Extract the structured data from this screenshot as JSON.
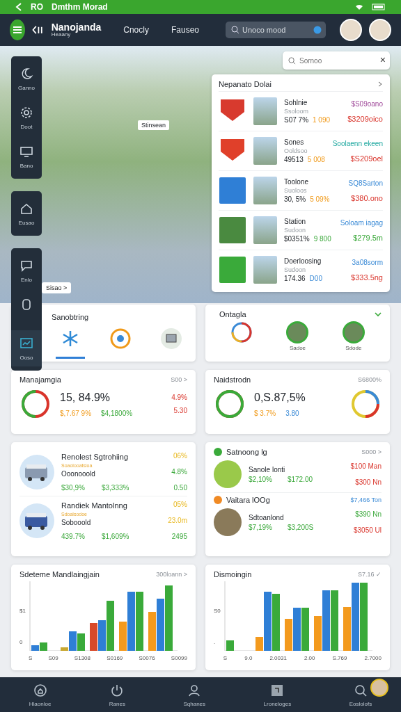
{
  "status_bar": {
    "carrier": "RO",
    "title": "Dmthm Morad"
  },
  "header": {
    "title": "Nanojanda",
    "subtitle": "Heaany",
    "nav": [
      "Cnocly",
      "Fauseo"
    ],
    "search": {
      "placeholder": "Unoco mood"
    }
  },
  "map": {
    "search": {
      "placeholder": "Sornoo",
      "close": "×"
    },
    "tags": [
      {
        "kind": "pin",
        "label": "Stinsean"
      },
      {
        "kind": "link",
        "label": "Sisao >"
      }
    ]
  },
  "sidebar": {
    "groups": [
      {
        "items": [
          {
            "label": "Ganno",
            "selected": false
          },
          {
            "label": "Doot",
            "selected": false
          },
          {
            "label": "Bano",
            "selected": false
          }
        ]
      },
      {
        "items": [
          {
            "label": "Eusao",
            "selected": false
          }
        ]
      },
      {
        "items": [
          {
            "label": "Enlo",
            "selected": false
          },
          {
            "selected": false
          },
          {
            "label": "Ooso",
            "selected": true
          }
        ]
      }
    ]
  },
  "list_card": {
    "title": "Nepanato Dolai",
    "rows": [
      {
        "kind": "shield",
        "color": "#d83a2e",
        "title": "Sohlnie",
        "subtitle": "Ssoloom",
        "value": "S07 7%",
        "change": "1 090",
        "top": "$S09oano",
        "bottom": "$3209oico"
      },
      {
        "kind": "shield",
        "color": "#e0402a",
        "title": "Sones",
        "subtitle": "Ooldsoo",
        "value": "49513",
        "change": "5 008",
        "top": "Soolaenn ekeen",
        "bottom": "$S209oel"
      },
      {
        "kind": "square",
        "color": "#2f7fd6",
        "title": "Toolone",
        "subtitle": "Suoloos",
        "value": "30, 5%",
        "change": "5 09%",
        "top": "SQ8Sarton",
        "bottom": "$380.ono"
      },
      {
        "kind": "photo",
        "color": "#4a8a40",
        "title": "Station",
        "subtitle": "Sudoon",
        "value": "$0351%",
        "change": "9 800",
        "top": "Soloam iagag",
        "bottom": "$279.5m"
      },
      {
        "kind": "square",
        "color": "#3aaa3a",
        "title": "Doerloosing",
        "subtitle": "Sudoon",
        "value": "174.36",
        "change": "D00",
        "top": "3a08sorm",
        "bottom": "$333.5ng"
      }
    ]
  },
  "tab_card": {
    "title": "Sanobtring",
    "tabs": [
      {
        "selected": true
      },
      {
        "selected": false
      },
      {
        "selected": false
      }
    ]
  },
  "place_card": {
    "title": "Ontagla",
    "items": [
      {
        "kind": "donut"
      },
      {
        "kind": "photo",
        "label": "Sadoe"
      },
      {
        "kind": "photo",
        "label": "Sdode"
      }
    ]
  },
  "stat_cards": [
    {
      "title": "Manajamgia",
      "link": "S00 >",
      "level": 0.5,
      "value": "15, 84.9%",
      "details": [
        "$,7.67 9%",
        "$4,1800%"
      ],
      "changes": [
        "4.9%",
        "5.30"
      ]
    },
    {
      "title": "Naidstrodn",
      "link": "S6800%",
      "level": 1,
      "value": "0,S.87,5%",
      "details": [
        "$ 3.7%",
        "3.80"
      ]
    }
  ],
  "service_card": {
    "rows": [
      {
        "title": "Renolest Sgtrohiing",
        "note": "Soaolooatsioa",
        "subtitle": "Ooonooold",
        "values": [
          "$30,9%",
          "$3,333%"
        ],
        "rates": [
          "06%",
          "4.8%",
          "0.50"
        ]
      },
      {
        "title": "Randiek Mantolnng",
        "note": "Sdoalsodoe",
        "subtitle": "Sobooold",
        "values": [
          "439.7%",
          "$1,609%"
        ],
        "rates": [
          "05%",
          "23.0m",
          "2495"
        ]
      }
    ]
  },
  "deal_card": {
    "sections": [
      {
        "title": "Satnoong lg",
        "color": "#3aaa3a",
        "link": "S000 >",
        "name": "Sanole lonti",
        "values": [
          "$2,10%",
          "$172.00"
        ],
        "prices": [
          "$100 Man",
          "$300 Nn"
        ]
      },
      {
        "title": "Vaitara lOOg",
        "color": "#f08a24",
        "link": "$7,466 Ton",
        "name": "Sdtoanlond",
        "values": [
          "$7,19%",
          "$3,200S"
        ],
        "prices": [
          "$390 Nn",
          "$3050 Ul"
        ]
      }
    ]
  },
  "chart_cards": [
    {
      "title": "Sdeteme Mandlaingjain",
      "link": "300loann >",
      "y_labels": [
        "$1",
        "0"
      ],
      "x_labels": [
        "S",
        "S09",
        "S1308",
        "S0169",
        "S0076",
        "S0099"
      ]
    },
    {
      "title": "Dismoingin",
      "link": "S7.16 ✓",
      "y_labels": [
        "S0",
        "."
      ],
      "x_labels": [
        "S",
        "9.0",
        "2.0031",
        "2.00",
        "S.769",
        "2.7000"
      ]
    }
  ],
  "bottom_nav": [
    {
      "label": "Hlaonloe",
      "selected": false
    },
    {
      "label": "Ranes",
      "selected": false
    },
    {
      "label": "Sqhanes",
      "selected": false
    },
    {
      "label": "Lroneloges",
      "selected": false
    },
    {
      "label": "Eoslolofs",
      "selected": false
    }
  ]
}
